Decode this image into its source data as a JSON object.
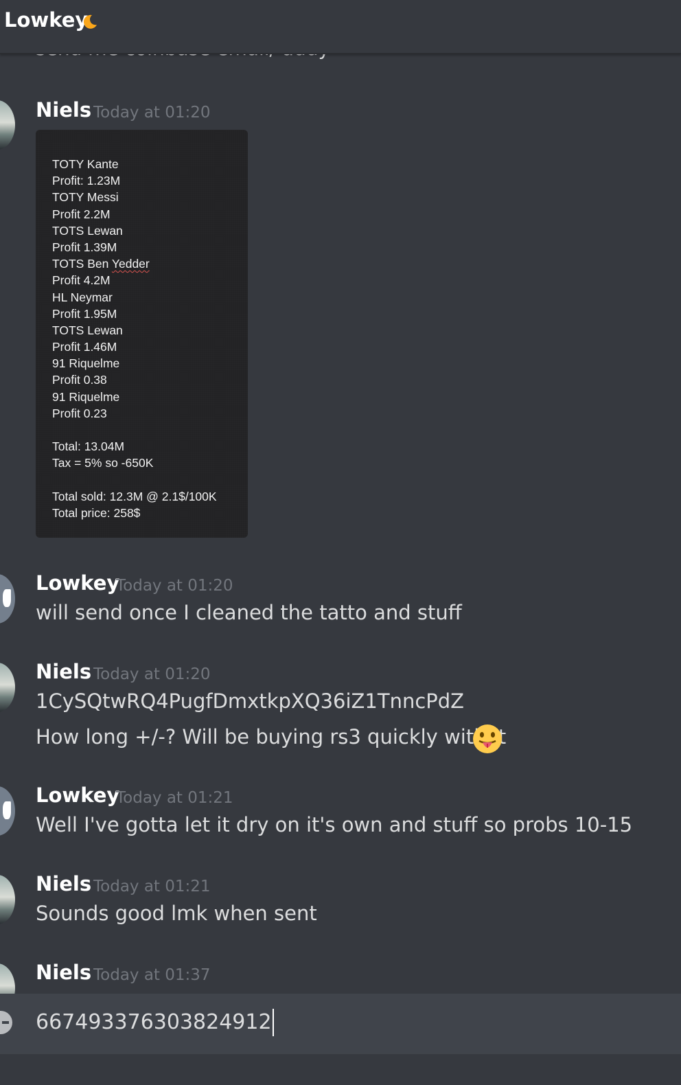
{
  "header": {
    "title": "Lowkey",
    "status_icon": "crescent-moon-icon",
    "status_color": "#faa61a"
  },
  "clipped_message": "send me coinbase email/ addy",
  "messages": [
    {
      "author": "Niels",
      "time": "Today at 01:20",
      "attachment": {
        "lines": [
          "TOTY Kante",
          "Profit: 1.23M",
          "TOTY Messi",
          "Profit 2.2M",
          "TOTS Lewan",
          "Profit 1.39M",
          "TOTS Ben Yedder",
          "Profit 4.2M",
          "HL Neymar",
          "Profit 1.95M",
          "TOTS Lewan",
          "Profit 1.46M",
          "91 Riquelme",
          "Profit 0.38",
          "91 Riquelme",
          "Profit 0.23",
          "",
          "Total:  13.04M",
          "Tax = 5% so -650K",
          "",
          "Total sold: 12.3M @ 2.1$/100K",
          "Total price: 258$"
        ]
      }
    },
    {
      "author": "Lowkey",
      "time": "Today at 01:20",
      "text": "will send once I cleaned the tatto and stuff"
    },
    {
      "author": "Niels",
      "time": "Today at 01:20",
      "text": "1CySQtwRQ4PugfDmxtkpXQ36iZ1TnncPdZ",
      "text2": "How long +/-? Will be buying rs3 quickly with it",
      "emoji": "tongue-out-emoji"
    },
    {
      "author": "Lowkey",
      "time": "Today at 01:21",
      "text": "Well I've gotta let it dry on it's own and stuff so probs 10-15"
    },
    {
      "author": "Niels",
      "time": "Today at 01:21",
      "text": "Sounds good lmk when sent"
    },
    {
      "author": "Niels",
      "time": "Today at 01:37"
    }
  ],
  "composer": {
    "value": "667493376303824912"
  },
  "colors": {
    "background": "#36393f",
    "composer": "#40444b",
    "username": "#ffffff",
    "timestamp": "#72767d"
  }
}
